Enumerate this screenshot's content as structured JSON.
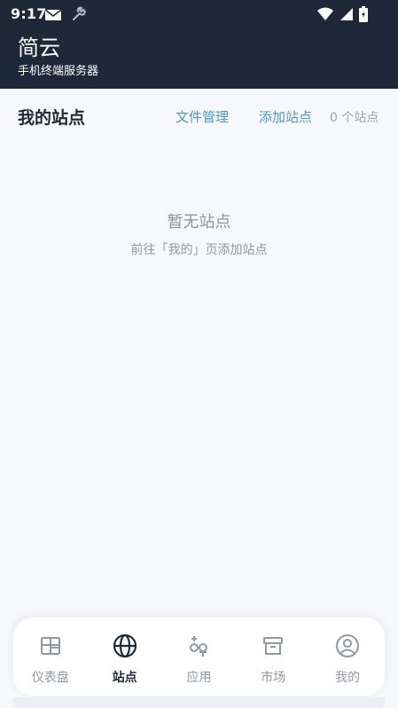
{
  "status_bar": {
    "time": "9:17",
    "left_icons": [
      "mail-icon",
      "wrench-icon"
    ],
    "right_icons": [
      "wifi-icon",
      "signal-icon",
      "battery-icon"
    ]
  },
  "header": {
    "title": "简云",
    "subtitle": "手机终端服务器"
  },
  "sites": {
    "title": "我的站点",
    "file_manage": "文件管理",
    "add_site": "添加站点",
    "count": "0 个站点"
  },
  "empty_state": {
    "title": "暂无站点",
    "hint": "前往「我的」页添加站点"
  },
  "nav": {
    "items": [
      {
        "label": "仪表盘",
        "icon": "dashboard-icon"
      },
      {
        "label": "站点",
        "icon": "globe-icon",
        "active": true
      },
      {
        "label": "应用",
        "icon": "apps-icon"
      },
      {
        "label": "市场",
        "icon": "market-box-icon"
      },
      {
        "label": "我的",
        "icon": "profile-icon"
      }
    ]
  },
  "colors": {
    "header_bg": "#1e2839",
    "page_bg": "#f6f8fb",
    "link": "#4f95d1",
    "muted": "#8f98a3",
    "active_nav": "#1e2839"
  }
}
